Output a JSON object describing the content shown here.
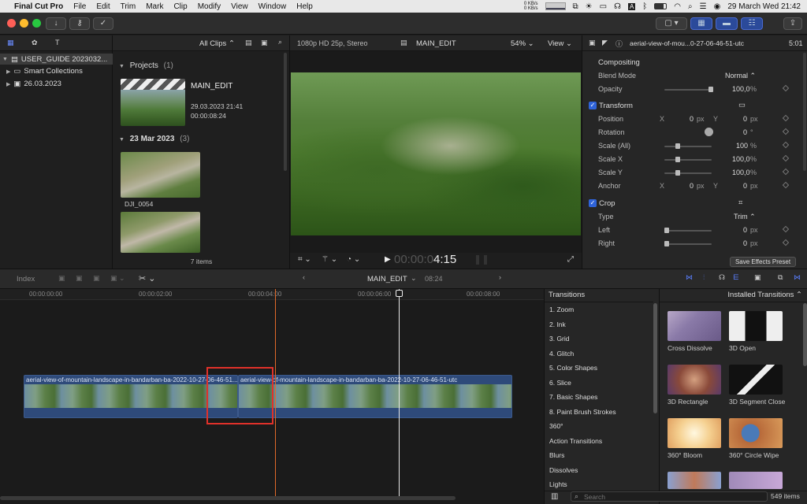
{
  "menubar": {
    "app_name": "Final Cut Pro",
    "menus": [
      "File",
      "Edit",
      "Trim",
      "Mark",
      "Clip",
      "Modify",
      "View",
      "Window",
      "Help"
    ],
    "net_up": "0 KB/s",
    "net_down": "0 KB/s",
    "clock": "29 March Wed  21:42"
  },
  "library": {
    "items": [
      {
        "label": "USER_GUIDE 2023032..."
      },
      {
        "label": "Smart Collections"
      },
      {
        "label": "26.03.2023"
      }
    ]
  },
  "browser": {
    "filter_label": "All Clips",
    "projects_header": "Projects",
    "projects_count": "(1)",
    "project_name": "MAIN_EDIT",
    "project_date": "29.03.2023 21:41",
    "project_duration": "00:00:08:24",
    "event_header": "23 Mar 2023",
    "event_count": "(3)",
    "clip1_name": "DJI_0054",
    "items_count": "7 items"
  },
  "viewer": {
    "format": "1080p HD 25p, Stereo",
    "project": "MAIN_EDIT",
    "zoom": "54%",
    "view_label": "View",
    "timecode_dim": "00:00:0",
    "timecode_bright": "4:15"
  },
  "inspector": {
    "clip_name": "aerial-view-of-mou...0-27-06-46-51-utc",
    "clip_duration": "5:01",
    "compositing": "Compositing",
    "blend_mode_label": "Blend Mode",
    "blend_mode_value": "Normal",
    "opacity_label": "Opacity",
    "opacity_value": "100,0",
    "opacity_unit": "%",
    "transform": "Transform",
    "position_label": "Position",
    "pos_x_label": "X",
    "pos_x": "0",
    "pos_y_label": "Y",
    "pos_y": "0",
    "px": "px",
    "rotation_label": "Rotation",
    "rotation_value": "0",
    "deg": "°",
    "scale_all_label": "Scale (All)",
    "scale_all_value": "100",
    "scale_x_label": "Scale X",
    "scale_x_value": "100,0",
    "scale_y_label": "Scale Y",
    "scale_y_value": "100,0",
    "anchor_label": "Anchor",
    "anchor_x": "0",
    "anchor_y": "0",
    "crop": "Crop",
    "type_label": "Type",
    "type_value": "Trim",
    "left_label": "Left",
    "left_value": "0",
    "right_label": "Right",
    "right_value": "0",
    "save_preset": "Save Effects Preset"
  },
  "timeline_bar": {
    "index_label": "Index",
    "project": "MAIN_EDIT",
    "duration": "08:24"
  },
  "timeline": {
    "ruler": [
      "00:00:00:00",
      "00:00:02:00",
      "00:00:04:00",
      "00:00:06:00",
      "00:00:08:00"
    ],
    "clip1_name": "aerial-view-of-mountain-landscape-in-bandarban-ba-2022-10-27-06-46-51...",
    "clip2_name": "aerial-view-of-mountain-landscape-in-bandarban-ba-2022-10-27-06-46-51-utc"
  },
  "transitions": {
    "header": "Transitions",
    "categories": [
      "1. Zoom",
      "2. Ink",
      "3. Grid",
      "4. Glitch",
      "5. Color Shapes",
      "6. Slice",
      "7. Basic Shapes",
      "8. Paint Brush Strokes",
      "360°",
      "Action Transitions",
      "Blurs",
      "Dissolves",
      "Lights"
    ],
    "installed_label": "Installed Transitions",
    "tiles": [
      {
        "name": "Cross Dissolve"
      },
      {
        "name": "3D Open"
      },
      {
        "name": "3D Rectangle"
      },
      {
        "name": "3D Segment Close"
      },
      {
        "name": "360° Bloom"
      },
      {
        "name": "360° Circle Wipe"
      }
    ],
    "search_placeholder": "Search",
    "count": "549 items"
  }
}
